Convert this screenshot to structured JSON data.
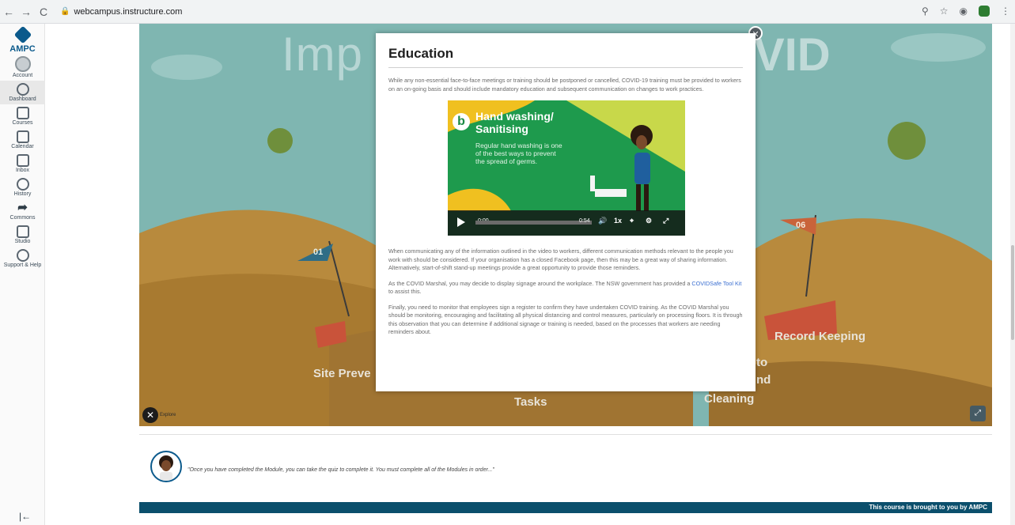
{
  "browser": {
    "url": "webcampus.instructure.com",
    "nav": {
      "back": "←",
      "forward": "→",
      "reload": "C"
    },
    "right_icons": [
      "zoom-icon",
      "star-icon",
      "extension-icon",
      "shield-icon",
      "menu-icon"
    ]
  },
  "sidebar": {
    "brand": "AMPC",
    "items": [
      {
        "label": "Account",
        "icon": "account-icon"
      },
      {
        "label": "Dashboard",
        "icon": "dashboard-icon"
      },
      {
        "label": "Courses",
        "icon": "courses-icon"
      },
      {
        "label": "Calendar",
        "icon": "calendar-icon"
      },
      {
        "label": "Inbox",
        "icon": "inbox-icon"
      },
      {
        "label": "History",
        "icon": "history-icon"
      },
      {
        "label": "Commons",
        "icon": "commons-icon"
      },
      {
        "label": "Studio",
        "icon": "studio-icon"
      },
      {
        "label": "Support & Help",
        "icon": "help-icon"
      }
    ],
    "collapse_label": "|←"
  },
  "stage": {
    "title_left": "Imp",
    "title_right": "COVID",
    "flag_01": "01",
    "flag_06": "06",
    "labels": {
      "site": "Site Preve",
      "record": "Record Keeping",
      "tasks": "Tasks",
      "cleaning": "Cleaning",
      "to": "to",
      "nd": "nd"
    },
    "close_label": "Explore"
  },
  "modal": {
    "title": "Education",
    "para1": "While any non-essential face-to-face meetings or training should be postponed or cancelled, COVID-19 training must be provided to workers on an on-going basis and should include mandatory education and subsequent communication on changes to work practices.",
    "video": {
      "badge": "b",
      "title": "Hand washing/ Sanitising",
      "subtitle": "Regular hand washing is one of the best ways to prevent the spread of germs.",
      "time_current": "0:00",
      "time_total": "0:54",
      "speed": "1x"
    },
    "para2": "When communicating any of the information outlined in the video to workers, different communication methods relevant to the people you work with should be considered. If your organisation has a closed Facebook page, then this may be a great way of sharing information. Alternatively, start-of-shift stand-up meetings provide a great opportunity to provide those reminders.",
    "para3_before": "As the COVID Marshal, you may decide to display signage around the workplace. The NSW government has provided a ",
    "para3_link": "COVIDSafe Tool Kit",
    "para3_after": " to assist this.",
    "para4": "Finally, you need to monitor that employees sign a register to confirm they have undertaken COVID training. As the COVID Marshal you should be monitoring, encouraging and facilitating all physical distancing and control measures, particularly on processing floors. It is through this observation that you can determine if additional signage or training is needed, based on the processes that workers are needing reminders about."
  },
  "footer": {
    "quote": "\"Once you have completed the Module, you can take the quiz to complete it. You must complete all of the Modules in order...\"",
    "banner": "This course is brought to you by AMPC"
  }
}
